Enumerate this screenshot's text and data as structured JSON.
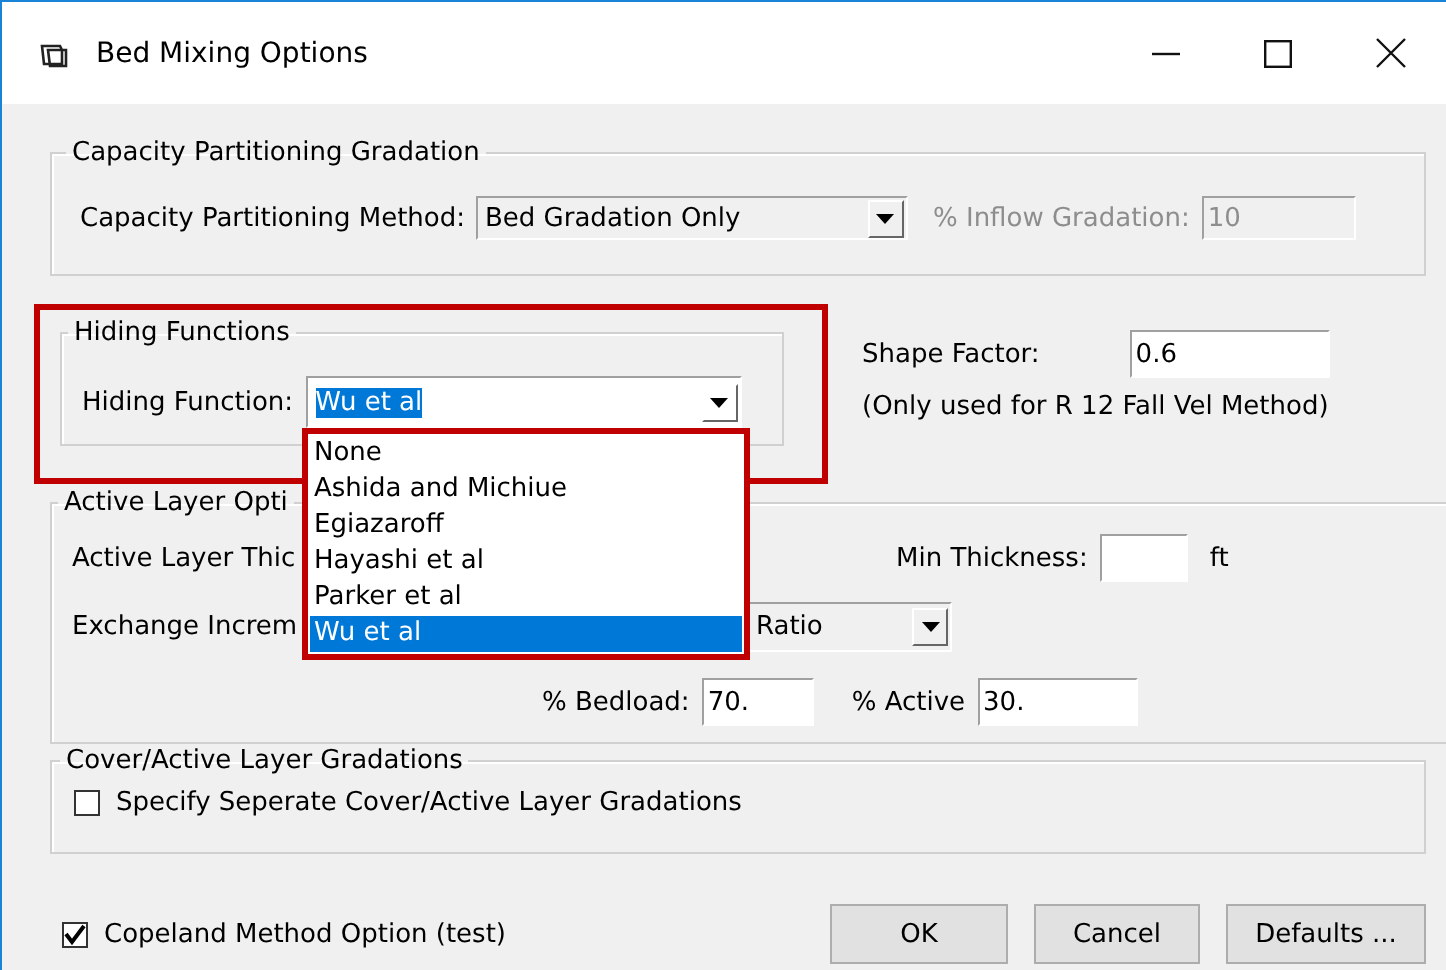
{
  "window": {
    "title": "Bed Mixing Options"
  },
  "capacity_partitioning": {
    "title": "Capacity Partitioning Gradation",
    "method_label": "Capacity Partitioning Method:",
    "method_value": "Bed Gradation Only",
    "inflow_label": "% Inflow Gradation:",
    "inflow_value": "10",
    "inflow_disabled": true
  },
  "hiding_functions": {
    "title": "Hiding Functions",
    "label": "Hiding Function:",
    "value": "Wu et al",
    "dropdown_open": true,
    "options": [
      {
        "label": "None",
        "selected": false
      },
      {
        "label": "Ashida and Michiue",
        "selected": false
      },
      {
        "label": "Egiazaroff",
        "selected": false
      },
      {
        "label": "Hayashi et al",
        "selected": false
      },
      {
        "label": "Parker et al",
        "selected": false
      },
      {
        "label": "Wu et al",
        "selected": true
      }
    ]
  },
  "shape_factor": {
    "label": "Shape Factor:",
    "value": "0.6",
    "note": "(Only used for R 12 Fall Vel Method)"
  },
  "active_layer": {
    "title": "Active Layer Opti",
    "thickness_label": "Active Layer Thic",
    "min_thickness_label": "Min Thickness:",
    "unit": "ft",
    "exchange_label": "Exchange Increm",
    "exchange_value": "Ratio",
    "bedload_label": "% Bedload:",
    "bedload_value": "70.",
    "active_label": "% Active",
    "active_value": "30."
  },
  "cover_layer": {
    "title": "Cover/Active Layer Gradations",
    "checkbox": {
      "label": "Specify Seperate Cover/Active Layer Gradations",
      "checked": false
    }
  },
  "copeland": {
    "label": "Copeland Method Option (test)",
    "checked": true
  },
  "buttons": [
    {
      "label": "OK"
    },
    {
      "label": "Cancel"
    },
    {
      "label": "Defaults ..."
    }
  ]
}
